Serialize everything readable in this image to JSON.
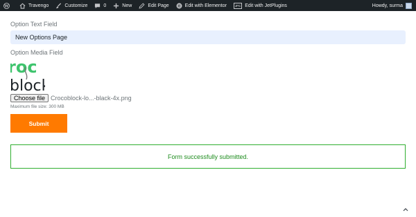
{
  "admin_bar": {
    "site_name": "Travengo",
    "customize": "Customize",
    "comments_count": "0",
    "new": "New",
    "edit_page": "Edit Page",
    "edit_elementor": "Edit with Elementor",
    "edit_jetplugins": "Edit with JetPlugins",
    "jet_badge": "JFC",
    "greeting": "Howdy, surma"
  },
  "form": {
    "text_label": "Option Text Field",
    "text_value": "New Options Page",
    "media_label": "Option Media Field",
    "choose_file": "Choose file",
    "file_name": "Crocoblock-lo...-black-4x.png",
    "max_size": "Maximum file size: 300 MB",
    "submit": "Submit"
  },
  "notice": {
    "message": "Form successfully submitted."
  },
  "preview_logo": {
    "line1": "roc",
    "line2": "block"
  },
  "colors": {
    "admin_bg": "#1d2327",
    "input_bg": "#e8f0fe",
    "submit_bg": "#ff7a00",
    "success": "#2fae2f",
    "logo_green": "#3ec46d"
  }
}
